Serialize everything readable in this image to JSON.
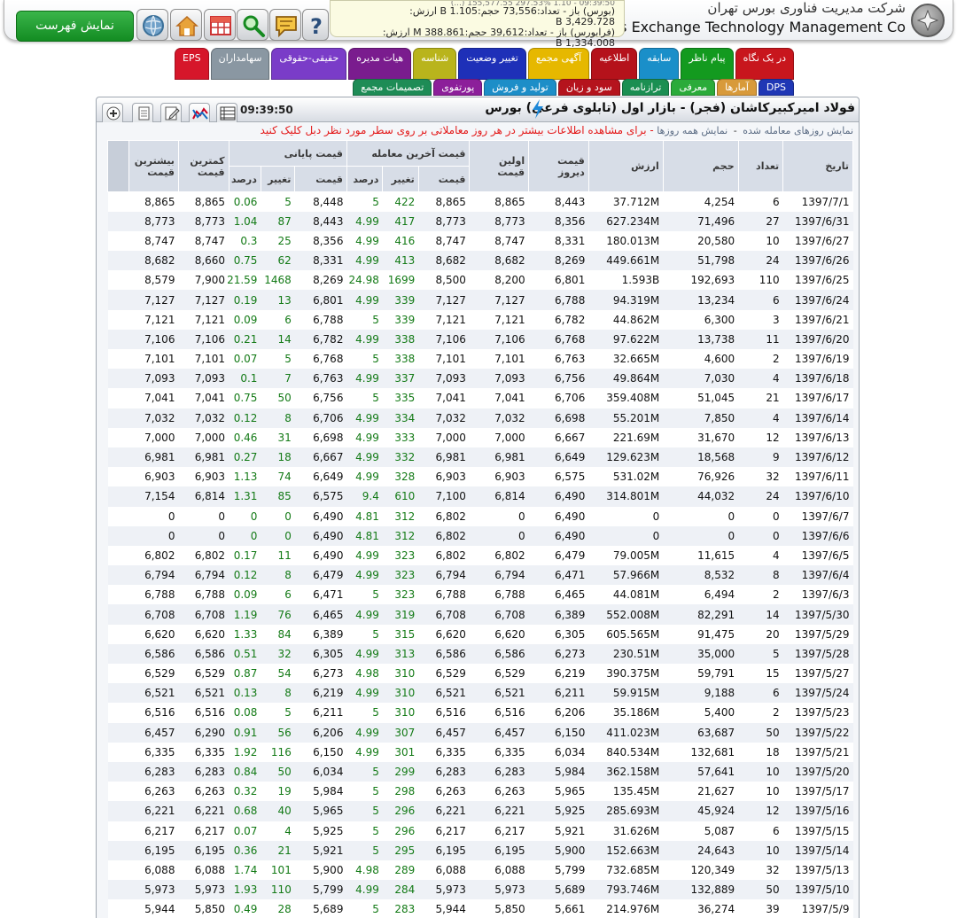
{
  "header": {
    "company_en": "urities Exchange Technology Management Co",
    "company_fa": "شرکت مدیریت فناوری بورس تهران",
    "show_list_label": "نمایش فهرست",
    "ticker_line0": "09:39:50 - 1.10 297.53% 155,577.55 (...)",
    "ticker_line1": "(بورس) باز - تعداد:73,556 حجم:B 1.105 ارزش:",
    "ticker_line2": "3,429.728 B",
    "ticker_line3": "(فرابورس) باز - تعداد:39,612 حجم:388.861 M ارزش:",
    "ticker_line4": "1,334.008 B"
  },
  "tabs_row1": [
    {
      "label": "در یک نگاه",
      "color": "#c8161d"
    },
    {
      "label": "پیام ناظر",
      "color": "#139a1f"
    },
    {
      "label": "سابقه",
      "color": "#1a8fc9"
    },
    {
      "label": "اطلاعیه",
      "color": "#b5121b"
    },
    {
      "label": "آگهی مجمع",
      "color": "#e6b800"
    },
    {
      "label": "تغییر وضعیت",
      "color": "#1e30b8"
    },
    {
      "label": "شناسه",
      "color": "#b9b41c"
    },
    {
      "label": "هیات مدیره",
      "color": "#7a1c8e"
    },
    {
      "label": "حقیقی-حقوقی",
      "color": "#7a3cc8"
    },
    {
      "label": "سهامداران",
      "color": "#8a97a2"
    },
    {
      "label": "EPS",
      "color": "#d6162a"
    }
  ],
  "tabs_row2": [
    {
      "label": "DPS",
      "color": "#1f37b5"
    },
    {
      "label": "آمارها",
      "color": "#d89a3a"
    },
    {
      "label": "معرفی",
      "color": "#2bab3a"
    },
    {
      "label": "ترازنامه",
      "color": "#1b8f52"
    },
    {
      "label": "سود و زیان",
      "color": "#b5141d"
    },
    {
      "label": "تولید و فروش",
      "color": "#1d8ec8"
    },
    {
      "label": "پورتفوی",
      "color": "#8c1f9a"
    },
    {
      "label": "تصمیمات مجمع",
      "color": "#1e8c56"
    }
  ],
  "panel": {
    "title": "فولاد امیرکبیرکاشان (فجر) - بازار اول (تابلوی فرعی) بورس",
    "clock": "09:39:50",
    "sub_note": "نمایش روزهای معامله شده",
    "sub_all": "نمایش همه روزها",
    "sub_dash": "-",
    "sub_hint": "- برای مشاهده اطلاعات بیشتر در هر روز معاملاتی بر روی سطر مورد نظر دبل کلیک کنید"
  },
  "table": {
    "headers": {
      "date": "تاریخ",
      "count": "تعداد",
      "volume": "حجم",
      "value": "ارزش",
      "yesterday": "قیمت دیروز",
      "first": "اولین قیمت",
      "last_group": "قیمت آخرین معامله",
      "closing_group": "قیمت پایانی",
      "low": "کمترین قیمت",
      "high": "بیشترین قیمت",
      "price": "قیمت",
      "change": "تغییر",
      "percent": "درصد"
    },
    "rows": [
      [
        "1397/7/1",
        "6",
        "4,254",
        "37.712M",
        "8,443",
        "8,865",
        "8,865",
        "422",
        "5",
        "8,448",
        "5",
        "0.06",
        "8,865",
        "8,865"
      ],
      [
        "1397/6/31",
        "27",
        "71,496",
        "627.234M",
        "8,356",
        "8,773",
        "8,773",
        "417",
        "4.99",
        "8,443",
        "87",
        "1.04",
        "8,773",
        "8,773"
      ],
      [
        "1397/6/27",
        "10",
        "20,580",
        "180.013M",
        "8,331",
        "8,747",
        "8,747",
        "416",
        "4.99",
        "8,356",
        "25",
        "0.3",
        "8,747",
        "8,747"
      ],
      [
        "1397/6/26",
        "24",
        "51,798",
        "449.661M",
        "8,269",
        "8,682",
        "8,682",
        "413",
        "4.99",
        "8,331",
        "62",
        "0.75",
        "8,660",
        "8,682"
      ],
      [
        "1397/6/25",
        "110",
        "192,693",
        "1.593B",
        "6,801",
        "8,200",
        "8,500",
        "1699",
        "24.98",
        "8,269",
        "1468",
        "21.59",
        "7,900",
        "8,579"
      ],
      [
        "1397/6/24",
        "6",
        "13,234",
        "94.319M",
        "6,788",
        "7,127",
        "7,127",
        "339",
        "4.99",
        "6,801",
        "13",
        "0.19",
        "7,127",
        "7,127"
      ],
      [
        "1397/6/21",
        "3",
        "6,300",
        "44.862M",
        "6,782",
        "7,121",
        "7,121",
        "339",
        "5",
        "6,788",
        "6",
        "0.09",
        "7,121",
        "7,121"
      ],
      [
        "1397/6/20",
        "11",
        "13,738",
        "97.622M",
        "6,768",
        "7,106",
        "7,106",
        "338",
        "4.99",
        "6,782",
        "14",
        "0.21",
        "7,106",
        "7,106"
      ],
      [
        "1397/6/19",
        "2",
        "4,600",
        "32.665M",
        "6,763",
        "7,101",
        "7,101",
        "338",
        "5",
        "6,768",
        "5",
        "0.07",
        "7,101",
        "7,101"
      ],
      [
        "1397/6/18",
        "4",
        "7,030",
        "49.864M",
        "6,756",
        "7,093",
        "7,093",
        "337",
        "4.99",
        "6,763",
        "7",
        "0.1",
        "7,093",
        "7,093"
      ],
      [
        "1397/6/17",
        "21",
        "51,045",
        "359.408M",
        "6,706",
        "7,041",
        "7,041",
        "335",
        "5",
        "6,756",
        "50",
        "0.75",
        "7,041",
        "7,041"
      ],
      [
        "1397/6/14",
        "4",
        "7,850",
        "55.201M",
        "6,698",
        "7,032",
        "7,032",
        "334",
        "4.99",
        "6,706",
        "8",
        "0.12",
        "7,032",
        "7,032"
      ],
      [
        "1397/6/13",
        "12",
        "31,670",
        "221.69M",
        "6,667",
        "7,000",
        "7,000",
        "333",
        "4.99",
        "6,698",
        "31",
        "0.46",
        "7,000",
        "7,000"
      ],
      [
        "1397/6/12",
        "9",
        "18,568",
        "129.623M",
        "6,649",
        "6,981",
        "6,981",
        "332",
        "4.99",
        "6,667",
        "18",
        "0.27",
        "6,981",
        "6,981"
      ],
      [
        "1397/6/11",
        "32",
        "76,926",
        "531.02M",
        "6,575",
        "6,903",
        "6,903",
        "328",
        "4.99",
        "6,649",
        "74",
        "1.13",
        "6,903",
        "6,903"
      ],
      [
        "1397/6/10",
        "24",
        "44,032",
        "314.801M",
        "6,490",
        "6,814",
        "7,100",
        "610",
        "9.4",
        "6,575",
        "85",
        "1.31",
        "6,814",
        "7,154"
      ],
      [
        "1397/6/7",
        "0",
        "0",
        "0",
        "6,490",
        "0",
        "6,802",
        "312",
        "4.81",
        "6,490",
        "0",
        "0",
        "0",
        "0"
      ],
      [
        "1397/6/6",
        "0",
        "0",
        "0",
        "6,490",
        "0",
        "6,802",
        "312",
        "4.81",
        "6,490",
        "0",
        "0",
        "0",
        "0"
      ],
      [
        "1397/6/5",
        "4",
        "11,615",
        "79.005M",
        "6,479",
        "6,802",
        "6,802",
        "323",
        "4.99",
        "6,490",
        "11",
        "0.17",
        "6,802",
        "6,802"
      ],
      [
        "1397/6/4",
        "8",
        "8,532",
        "57.966M",
        "6,471",
        "6,794",
        "6,794",
        "323",
        "4.99",
        "6,479",
        "8",
        "0.12",
        "6,794",
        "6,794"
      ],
      [
        "1397/6/3",
        "2",
        "6,494",
        "44.081M",
        "6,465",
        "6,788",
        "6,788",
        "323",
        "5",
        "6,471",
        "6",
        "0.09",
        "6,788",
        "6,788"
      ],
      [
        "1397/5/30",
        "14",
        "82,291",
        "552.008M",
        "6,389",
        "6,708",
        "6,708",
        "319",
        "4.99",
        "6,465",
        "76",
        "1.19",
        "6,708",
        "6,708"
      ],
      [
        "1397/5/29",
        "20",
        "91,475",
        "605.565M",
        "6,305",
        "6,620",
        "6,620",
        "315",
        "5",
        "6,389",
        "84",
        "1.33",
        "6,620",
        "6,620"
      ],
      [
        "1397/5/28",
        "5",
        "35,000",
        "230.51M",
        "6,273",
        "6,586",
        "6,586",
        "313",
        "4.99",
        "6,305",
        "32",
        "0.51",
        "6,586",
        "6,586"
      ],
      [
        "1397/5/27",
        "15",
        "59,791",
        "390.375M",
        "6,219",
        "6,529",
        "6,529",
        "310",
        "4.98",
        "6,273",
        "54",
        "0.87",
        "6,529",
        "6,529"
      ],
      [
        "1397/5/24",
        "6",
        "9,188",
        "59.915M",
        "6,211",
        "6,521",
        "6,521",
        "310",
        "4.99",
        "6,219",
        "8",
        "0.13",
        "6,521",
        "6,521"
      ],
      [
        "1397/5/23",
        "2",
        "5,400",
        "35.186M",
        "6,206",
        "6,516",
        "6,516",
        "310",
        "5",
        "6,211",
        "5",
        "0.08",
        "6,516",
        "6,516"
      ],
      [
        "1397/5/22",
        "50",
        "63,687",
        "411.023M",
        "6,150",
        "6,457",
        "6,457",
        "307",
        "4.99",
        "6,206",
        "56",
        "0.91",
        "6,290",
        "6,457"
      ],
      [
        "1397/5/21",
        "18",
        "132,681",
        "840.534M",
        "6,034",
        "6,335",
        "6,335",
        "301",
        "4.99",
        "6,150",
        "116",
        "1.92",
        "6,335",
        "6,335"
      ],
      [
        "1397/5/20",
        "10",
        "57,641",
        "362.158M",
        "5,984",
        "6,283",
        "6,283",
        "299",
        "5",
        "6,034",
        "50",
        "0.84",
        "6,283",
        "6,283"
      ],
      [
        "1397/5/17",
        "10",
        "21,627",
        "135.45M",
        "5,965",
        "6,263",
        "6,263",
        "298",
        "5",
        "5,984",
        "19",
        "0.32",
        "6,263",
        "6,263"
      ],
      [
        "1397/5/16",
        "12",
        "45,924",
        "285.693M",
        "5,925",
        "6,221",
        "6,221",
        "296",
        "5",
        "5,965",
        "40",
        "0.68",
        "6,221",
        "6,221"
      ],
      [
        "1397/5/15",
        "6",
        "5,087",
        "31.626M",
        "5,921",
        "6,217",
        "6,217",
        "296",
        "5",
        "5,925",
        "4",
        "0.07",
        "6,217",
        "6,217"
      ],
      [
        "1397/5/14",
        "10",
        "24,643",
        "152.663M",
        "5,900",
        "6,195",
        "6,195",
        "295",
        "5",
        "5,921",
        "21",
        "0.36",
        "6,195",
        "6,195"
      ],
      [
        "1397/5/13",
        "32",
        "120,349",
        "732.685M",
        "5,799",
        "6,088",
        "6,088",
        "289",
        "4.98",
        "5,900",
        "101",
        "1.74",
        "6,088",
        "6,088"
      ],
      [
        "1397/5/10",
        "50",
        "132,889",
        "793.746M",
        "5,689",
        "5,973",
        "5,973",
        "284",
        "4.99",
        "5,799",
        "110",
        "1.93",
        "5,973",
        "5,973"
      ],
      [
        "1397/5/9",
        "39",
        "36,274",
        "214.976M",
        "5,661",
        "5,850",
        "5,944",
        "283",
        "5",
        "5,689",
        "28",
        "0.49",
        "5,850",
        "5,944"
      ]
    ]
  }
}
